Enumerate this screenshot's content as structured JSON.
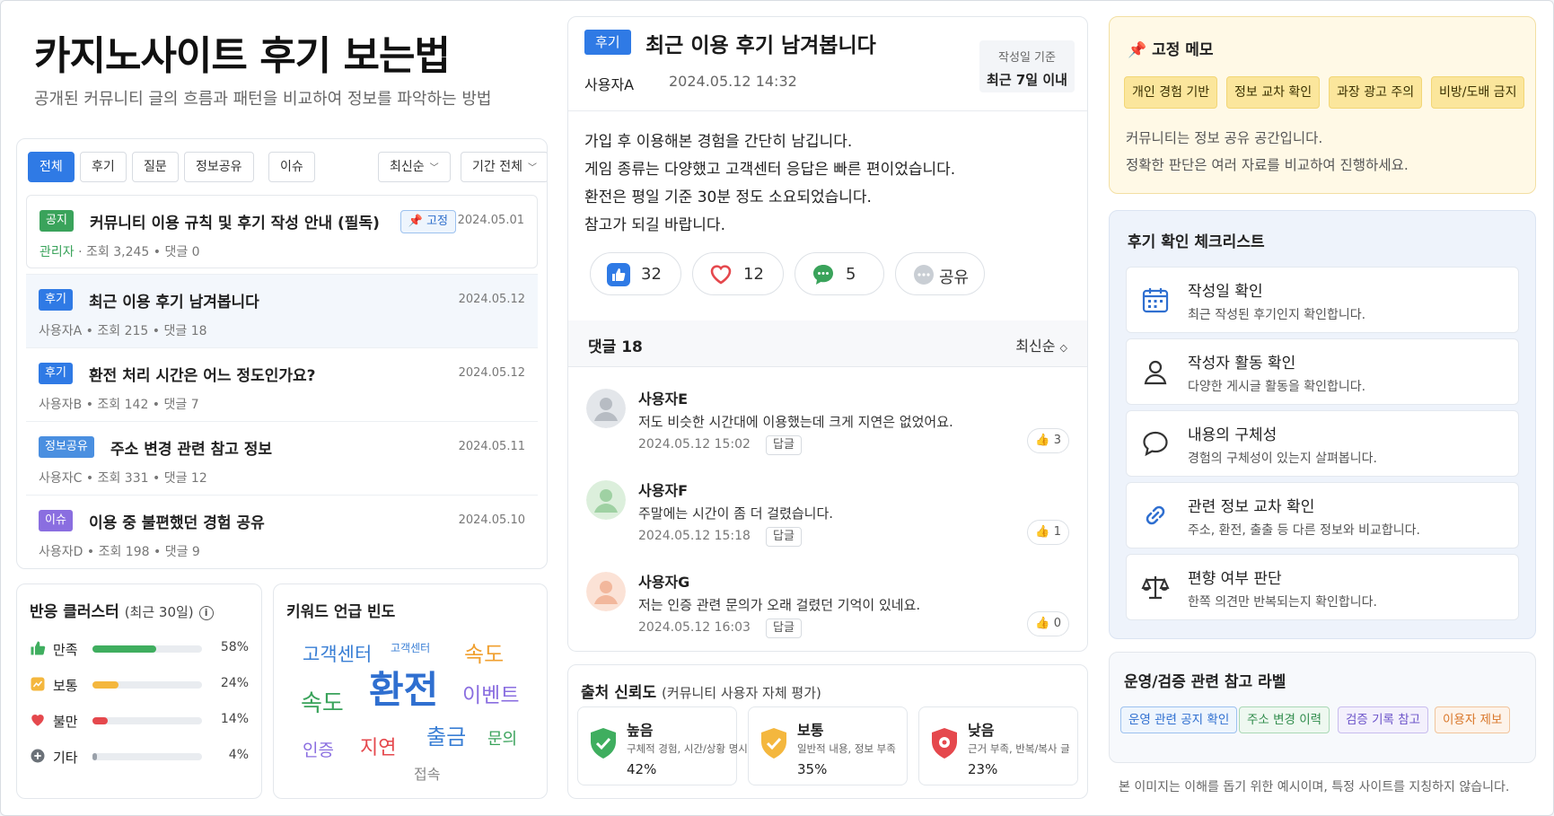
{
  "header": {
    "title": "카지노사이트 후기 보는법",
    "subtitle": "공개된 커뮤니티 글의 흐름과 패턴을 비교하여 정보를 파악하는 방법"
  },
  "board": {
    "filters": [
      "전체",
      "후기",
      "질문",
      "정보공유",
      "이슈"
    ],
    "sort": "최신순",
    "period": "기간 전체",
    "pin_label": "📌 고정",
    "posts": [
      {
        "tag": "공지",
        "tag_color": "#3aa35b",
        "title": "커뮤니티 이용 규칙 및 후기 작성 안내 (필독)",
        "date": "2024.05.01",
        "author": "관리자",
        "views": "조회 3,245",
        "comments": "댓글 0"
      },
      {
        "tag": "후기",
        "tag_color": "#2f7ae5",
        "title": "최근 이용 후기 남겨봅니다",
        "date": "2024.05.12",
        "author": "사용자A",
        "views": "조회 215",
        "comments": "댓글 18"
      },
      {
        "tag": "후기",
        "tag_color": "#2f7ae5",
        "title": "환전 처리 시간은 어느 정도인가요?",
        "date": "2024.05.12",
        "author": "사용자B",
        "views": "조회 142",
        "comments": "댓글 7"
      },
      {
        "tag": "정보공유",
        "tag_color": "#4a8fe0",
        "title": "주소 변경 관련 참고 정보",
        "date": "2024.05.11",
        "author": "사용자C",
        "views": "조회 331",
        "comments": "댓글 12"
      },
      {
        "tag": "이슈",
        "tag_color": "#8a6ee0",
        "title": "이용 중 불편했던 경험 공유",
        "date": "2024.05.10",
        "author": "사용자D",
        "views": "조회 198",
        "comments": "댓글 9"
      }
    ]
  },
  "cluster": {
    "title": "반응 클러스터",
    "period": "(최근 30일)",
    "info_icon": "i",
    "rows": [
      {
        "label": "만족",
        "pct_label": "58%",
        "value": 0.58,
        "color": "#3fae5f",
        "icon": "thumb-up-icon"
      },
      {
        "label": "보통",
        "pct_label": "24%",
        "value": 0.24,
        "color": "#f4b73e",
        "icon": "neutral-chart-icon"
      },
      {
        "label": "불만",
        "pct_label": "14%",
        "value": 0.14,
        "color": "#e5484d",
        "icon": "heart-icon"
      },
      {
        "label": "기타",
        "pct_label": "4%",
        "value": 0.04,
        "color": "#9aa1aa",
        "icon": "plus-circle-icon"
      }
    ]
  },
  "keywords": {
    "title": "키워드 언급 빈도",
    "words": [
      {
        "text": "고객센터",
        "color": "#3a7fd5"
      },
      {
        "text": "고객센터",
        "color": "#3a7fd5"
      },
      {
        "text": "속도",
        "color": "#f0a030"
      },
      {
        "text": "환전",
        "color": "#2f6fd0"
      },
      {
        "text": "속도",
        "color": "#3aa35b"
      },
      {
        "text": "이벤트",
        "color": "#8a6ee0"
      },
      {
        "text": "인증",
        "color": "#8a6ee0"
      },
      {
        "text": "지연",
        "color": "#e5484d"
      },
      {
        "text": "출금",
        "color": "#3a7fd5"
      },
      {
        "text": "문의",
        "color": "#3aa35b"
      },
      {
        "text": "접속",
        "color": "#888888"
      }
    ]
  },
  "post": {
    "tag": "후기",
    "title": "최근 이용 후기 남겨봅니다",
    "author": "사용자A",
    "datetime": "2024.05.12 14:32",
    "basis_label": "작성일 기준",
    "basis_value": "최근 7일 이내",
    "body": [
      "가입 후 이용해본 경험을 간단히 남깁니다.",
      "게임 종류는 다양했고 고객센터 응답은 빠른 편이었습니다.",
      "환전은 평일 기준 30분 정도 소요되었습니다.",
      "참고가 되길 바랍니다."
    ],
    "reactions": {
      "likes": "32",
      "hearts": "12",
      "comments": "5",
      "share": "공유"
    }
  },
  "comments": {
    "title": "댓글 18",
    "sort": "최신순",
    "reply_label": "답글",
    "items": [
      {
        "name": "사용자E",
        "text": "저도 비슷한 시간대에 이용했는데 크게 지연은 없었어요.",
        "datetime": "2024.05.12 15:02",
        "likes": "3",
        "avatar_color": "#cfd3d8"
      },
      {
        "name": "사용자F",
        "text": "주말에는 시간이 좀 더 걸렸습니다.",
        "datetime": "2024.05.12 15:18",
        "likes": "1",
        "avatar_color": "#cde8cf"
      },
      {
        "name": "사용자G",
        "text": "저는 인증 관련 문의가 오래 걸렸던 기억이 있네요.",
        "datetime": "2024.05.12 16:03",
        "likes": "0",
        "avatar_color": "#f6d2c2"
      }
    ]
  },
  "reliability": {
    "title": "출처 신뢰도",
    "subtitle": "(커뮤니티 사용자 자체 평가)",
    "levels": [
      {
        "label": "높음",
        "desc": "구체적 경험, 시간/상황 명시",
        "pct": "42%",
        "color": "#3fae5f"
      },
      {
        "label": "보통",
        "desc": "일반적 내용, 정보 부족",
        "pct": "35%",
        "color": "#f4b73e"
      },
      {
        "label": "낮음",
        "desc": "근거 부족, 반복/복사 글",
        "pct": "23%",
        "color": "#e5484d"
      }
    ]
  },
  "memo": {
    "title": "고정 메모",
    "chips": [
      "개인 경험 기반",
      "정보 교차 확인",
      "과장 광고 주의",
      "비방/도배 금지"
    ],
    "text": [
      "커뮤니티는 정보 공유 공간입니다.",
      "정확한 판단은 여러 자료를 비교하여 진행하세요."
    ]
  },
  "checklist": {
    "title": "후기 확인 체크리스트",
    "items": [
      {
        "title": "작성일 확인",
        "desc": "최근 작성된 후기인지 확인합니다.",
        "icon": "calendar-icon"
      },
      {
        "title": "작성자 활동 확인",
        "desc": "다양한 게시글 활동을 확인합니다.",
        "icon": "user-icon"
      },
      {
        "title": "내용의 구체성",
        "desc": "경험의 구체성이 있는지 살펴봅니다.",
        "icon": "chat-bubble-icon"
      },
      {
        "title": "관련 정보 교차 확인",
        "desc": "주소, 환전, 출출 등 다른 정보와 비교합니다.",
        "icon": "link-icon"
      },
      {
        "title": "편향 여부 판단",
        "desc": "한쪽 의견만 반복되는지 확인합니다.",
        "icon": "scale-icon"
      }
    ]
  },
  "labels": {
    "title": "운영/검증 관련 참고 라벨",
    "items": [
      {
        "text": "운영 관련 공지 확인",
        "color": "#2f6fd0",
        "bg": "#eef5fd"
      },
      {
        "text": "주소 변경 이력",
        "color": "#2e8b4a",
        "bg": "#eef8f0"
      },
      {
        "text": "검증 기록 참고",
        "color": "#6b53c9",
        "bg": "#f3f0fc"
      },
      {
        "text": "이용자 제보",
        "color": "#d9772a",
        "bg": "#fdf3ea"
      }
    ]
  },
  "footer": "본 이미지는 이해를 돕기 위한 예시이며, 특정 사이트를 지칭하지 않습니다."
}
